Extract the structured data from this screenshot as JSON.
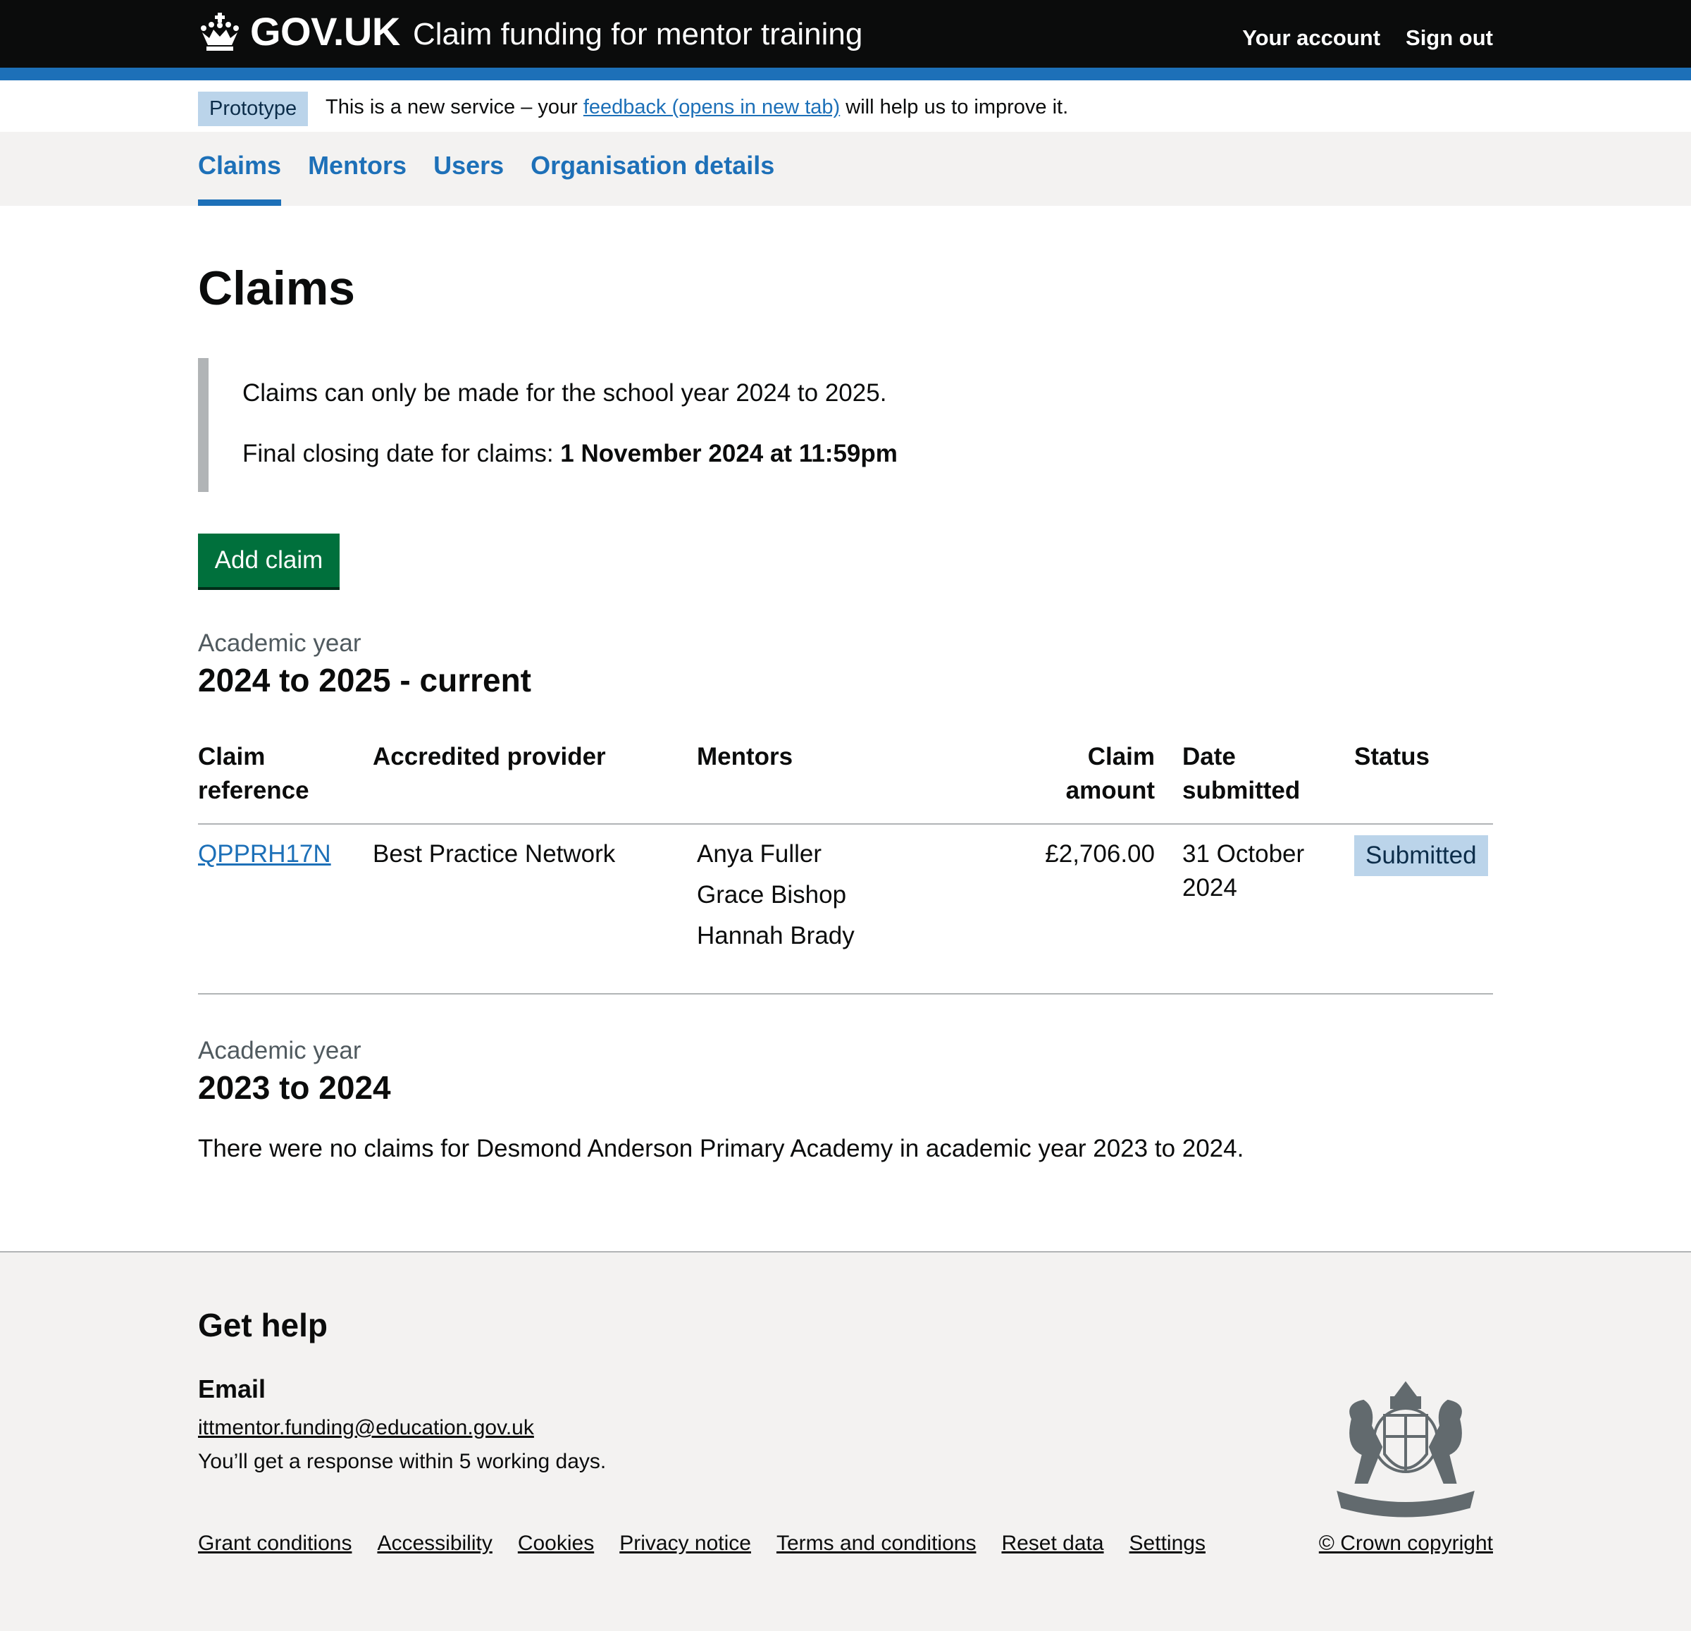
{
  "header": {
    "logo_text": "GOV.UK",
    "service_name": "Claim funding for mentor training",
    "nav": [
      "Your account",
      "Sign out"
    ]
  },
  "phase_banner": {
    "tag": "Prototype",
    "text_before": "This is a new service – your ",
    "link": "feedback (opens in new tab)",
    "text_after": " will help us to improve it."
  },
  "service_nav": {
    "items": [
      "Claims",
      "Mentors",
      "Users",
      "Organisation details"
    ],
    "active": "Claims"
  },
  "page": {
    "title": "Claims",
    "inset_line1": "Claims can only be made for the school year 2024 to 2025.",
    "inset_line2_prefix": "Final closing date for claims: ",
    "inset_line2_bold": "1 November 2024 at 11:59pm",
    "add_button": "Add claim"
  },
  "current_year": {
    "caption": "Academic year",
    "heading": "2024 to 2025 - current",
    "columns": {
      "ref1": "Claim",
      "ref2": "reference",
      "provider": "Accredited provider",
      "mentors": "Mentors",
      "amount1": "Claim",
      "amount2": "amount",
      "date1": "Date",
      "date2": "submitted",
      "status": "Status"
    },
    "rows": [
      {
        "reference": "QPPRH17N",
        "provider": "Best Practice Network",
        "mentors": [
          "Anya Fuller",
          "Grace Bishop",
          "Hannah Brady"
        ],
        "amount": "£2,706.00",
        "date_line1": "31 October",
        "date_line2": "2024",
        "status": "Submitted"
      }
    ]
  },
  "previous_year": {
    "caption": "Academic year",
    "heading": "2023 to 2024",
    "message": "There were no claims for Desmond Anderson Primary Academy in academic year 2023 to 2024."
  },
  "footer": {
    "heading": "Get help",
    "email_label": "Email",
    "email": "ittmentor.funding@education.gov.uk",
    "response": "You’ll get a response within 5 working days.",
    "links": [
      "Grant conditions",
      "Accessibility",
      "Cookies",
      "Privacy notice",
      "Terms and conditions",
      "Reset data",
      "Settings"
    ],
    "copyright": "© Crown copyright"
  },
  "colors": {
    "header_bg": "#0b0c0c",
    "brand_blue": "#1d70b8",
    "button_green": "#00703c",
    "tag_blue": "#bbd4ea",
    "footer_bg": "#f3f2f1"
  }
}
